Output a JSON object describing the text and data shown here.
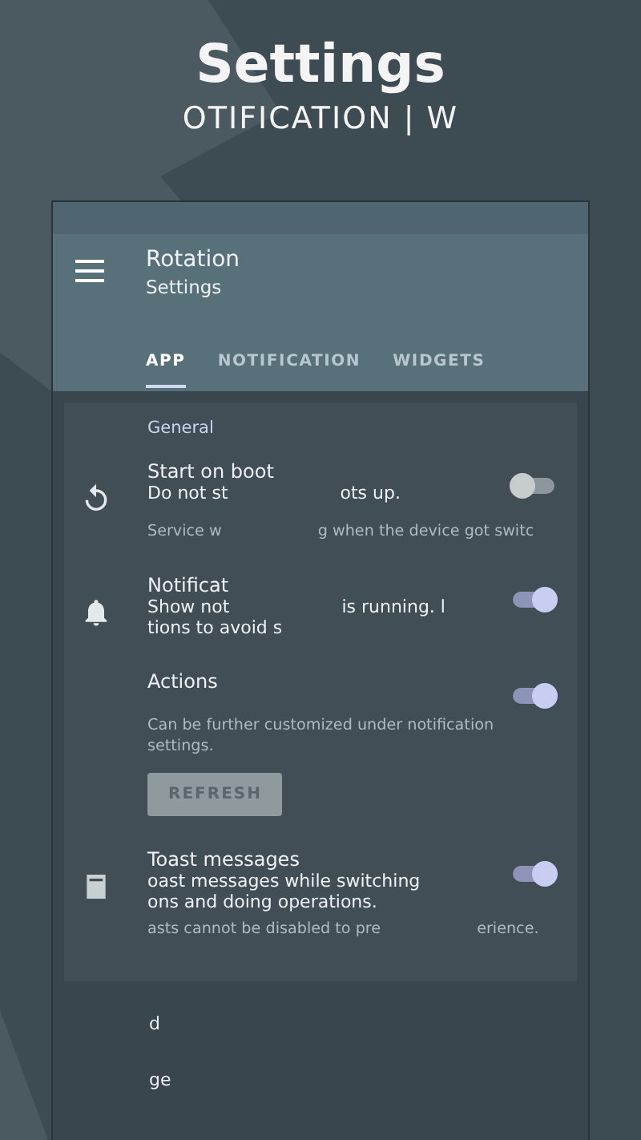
{
  "promo": {
    "title": "Settings",
    "subtitle": "OTIFICATION | W"
  },
  "app_bar": {
    "title": "Rotation",
    "subtitle": "Settings"
  },
  "tabs": [
    {
      "label": "APP",
      "selected": true
    },
    {
      "label": "NOTIFICATION",
      "selected": false
    },
    {
      "label": "WIDGETS",
      "selected": false
    }
  ],
  "section": "General",
  "items": [
    {
      "kind": "toggle",
      "title": "Start on boot",
      "description": [
        "Do not st",
        "ots up."
      ],
      "note": [
        "Service w",
        "g when the device got switc"
      ],
      "on": false
    },
    {
      "kind": "toggle",
      "title": "Notificat",
      "description": [
        "Show not",
        "is running. l",
        "tions to avoid s"
      ],
      "on": true
    },
    {
      "kind": "toggle",
      "title": "Actions",
      "note": [
        "Can be further customized under notification settings."
      ],
      "on": true,
      "button": "REFRESH"
    },
    {
      "kind": "toggle",
      "title": "Toast messages",
      "description": [
        "oast messages while switching",
        "ons and doing operations."
      ],
      "note": [
        "asts cannot be disabled to pre",
        "erience."
      ],
      "on": true
    }
  ],
  "partial_rows": [
    "d",
    "ge"
  ]
}
